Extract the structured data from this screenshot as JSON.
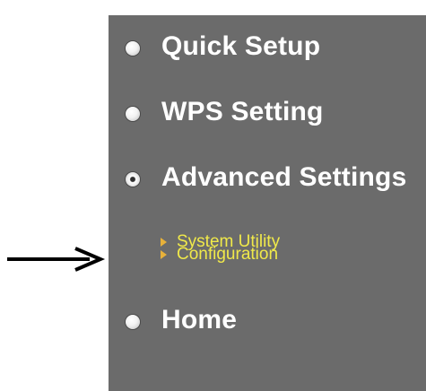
{
  "menu": {
    "items": [
      {
        "label": "Quick Setup",
        "icon": "bullet-icon"
      },
      {
        "label": "WPS Setting",
        "icon": "bullet-icon"
      },
      {
        "label": "Advanced Settings",
        "icon": "bullet-open-icon",
        "expanded": true,
        "children": [
          {
            "label": "System Utility",
            "icon": "triangle-right-icon"
          },
          {
            "label": "Configuration",
            "icon": "triangle-right-icon"
          }
        ]
      },
      {
        "label": "Home",
        "icon": "bullet-icon"
      }
    ]
  },
  "colors": {
    "panel_bg": "#6b6b6b",
    "item_text": "#ffffff",
    "subitem_text": "#f0e94a",
    "subitem_triangle": "#e7b13a",
    "arrow": "#000000"
  }
}
